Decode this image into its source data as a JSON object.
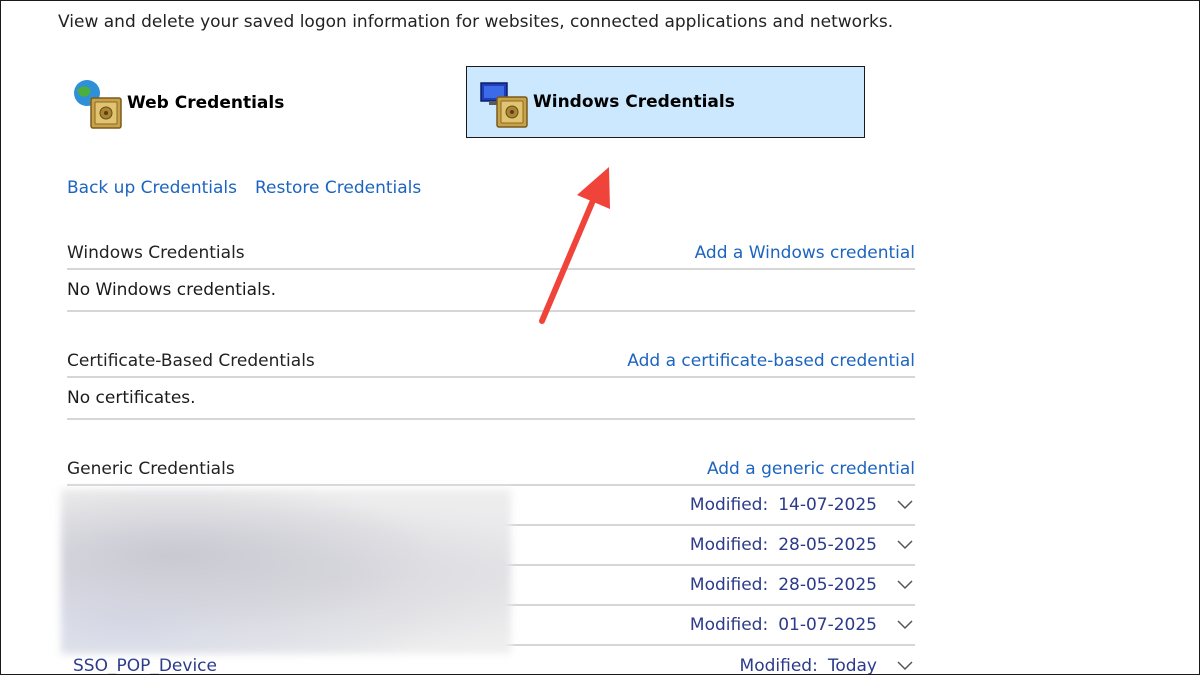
{
  "intro_text": "View and delete your saved logon information for websites, connected applications and networks.",
  "tiles": {
    "web": {
      "label": "Web Credentials",
      "icon": "globe-vault-icon"
    },
    "windows": {
      "label": "Windows Credentials",
      "icon": "computer-vault-icon",
      "selected": true
    }
  },
  "actions": {
    "backup": "Back up Credentials",
    "restore": "Restore Credentials"
  },
  "sections": {
    "windows": {
      "title": "Windows Credentials",
      "add_link": "Add a Windows credential",
      "empty_text": "No Windows credentials."
    },
    "certificate": {
      "title": "Certificate-Based Credentials",
      "add_link": "Add a certificate-based credential",
      "empty_text": "No certificates."
    },
    "generic": {
      "title": "Generic Credentials",
      "add_link": "Add a generic credential",
      "rows": [
        {
          "name": "",
          "modified_label": "Modified:",
          "modified": "14-07-2025"
        },
        {
          "name": "",
          "modified_label": "Modified:",
          "modified": "28-05-2025"
        },
        {
          "name": "",
          "modified_label": "Modified:",
          "modified": "28-05-2025"
        },
        {
          "name": "",
          "modified_label": "Modified:",
          "modified": "01-07-2025"
        },
        {
          "name": "SSO_POP_Device",
          "modified_label": "Modified:",
          "modified": "Today"
        }
      ]
    }
  },
  "colors": {
    "link": "#1c64c0",
    "selected_tile": "#cce8ff",
    "row_text": "#2b3a8a",
    "annotation_arrow": "#f0443a"
  }
}
